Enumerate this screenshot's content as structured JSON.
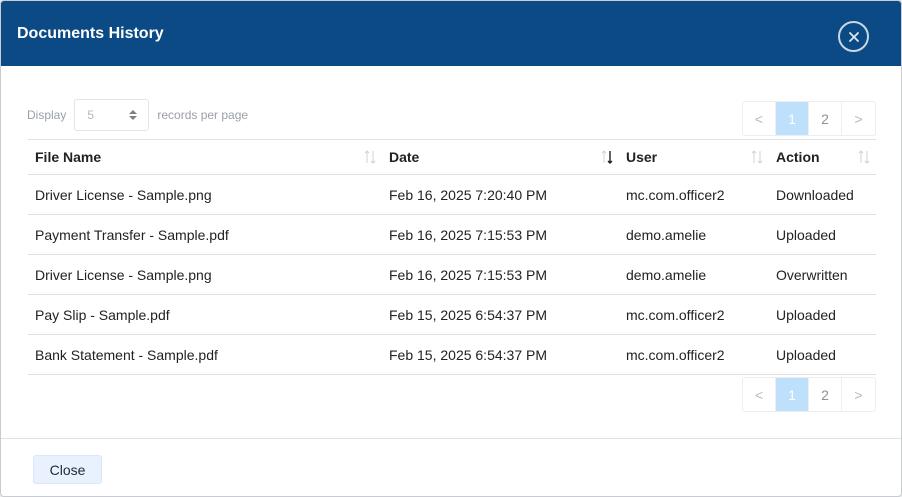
{
  "modal": {
    "title": "Documents History",
    "close_icon": "close-circle-icon",
    "footer_close_label": "Close"
  },
  "controls": {
    "display_label": "Display",
    "page_size": "5",
    "records_label": "records per page"
  },
  "pagination": {
    "prev": "<",
    "next": ">",
    "pages": [
      "1",
      "2"
    ],
    "current": "1"
  },
  "table": {
    "columns": [
      "File Name",
      "Date",
      "User",
      "Action"
    ],
    "sort_column": "Date",
    "sort_direction": "descending",
    "rows": [
      [
        "Driver License - Sample.png",
        "Feb 16, 2025 7:20:40 PM",
        "mc.com.officer2",
        "Downloaded"
      ],
      [
        "Payment Transfer - Sample.pdf",
        "Feb 16, 2025 7:15:53 PM",
        "demo.amelie",
        "Uploaded"
      ],
      [
        "Driver License - Sample.png",
        "Feb 16, 2025 7:15:53 PM",
        "demo.amelie",
        "Overwritten"
      ],
      [
        "Pay Slip - Sample.pdf",
        "Feb 15, 2025 6:54:37 PM",
        "mc.com.officer2",
        "Uploaded"
      ],
      [
        "Bank Statement - Sample.pdf",
        "Feb 15, 2025 6:54:37 PM",
        "mc.com.officer2",
        "Uploaded"
      ]
    ]
  },
  "colors": {
    "header_bg": "#0b4a85",
    "active_page_bg": "#bfe0fb",
    "close_button_bg": "#e8f1fd"
  }
}
